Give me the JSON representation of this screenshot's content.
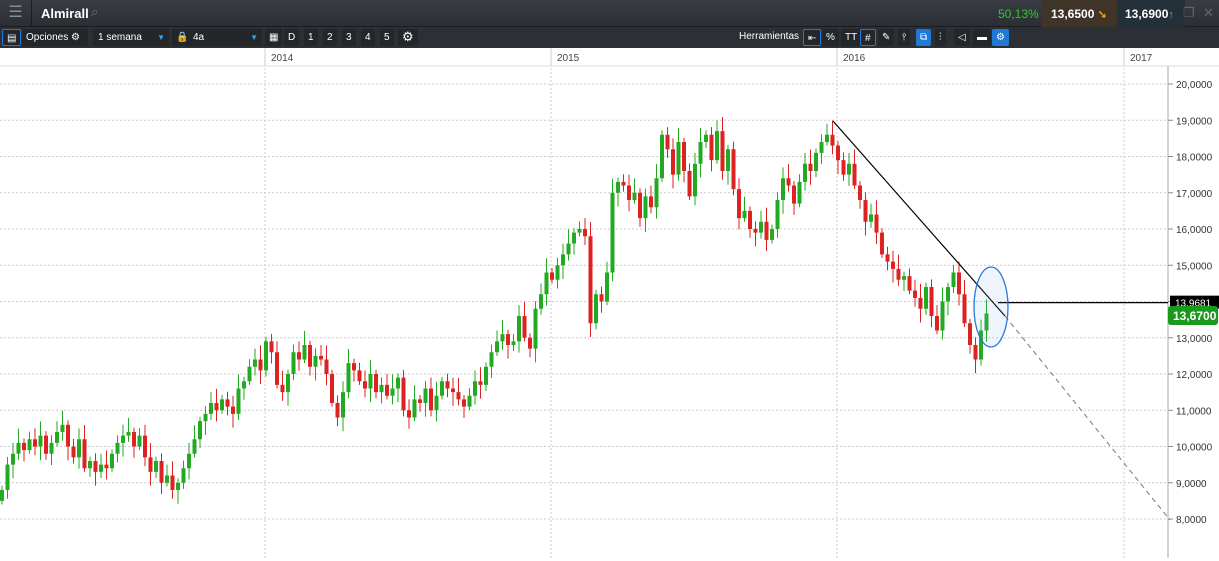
{
  "header": {
    "menu_icon": "hamburger-icon",
    "title": "Almirall",
    "search_icon": "search-icon",
    "change_pct": "50,13%",
    "bid": "13,6500",
    "ask": "13,6900"
  },
  "toolbar": {
    "options_label": "Opciones",
    "period": "1 semana",
    "range": "4a",
    "day_label": "D",
    "range_buttons": [
      "1",
      "2",
      "3",
      "4",
      "5"
    ],
    "tools_label": "Herramientas",
    "percent": "%",
    "text_tool": "TT"
  },
  "colors": {
    "up": "#22aa22",
    "down": "#dd2222",
    "price_badge": "#1a9a1a"
  },
  "chart_data": {
    "type": "candlestick",
    "title": "Almirall",
    "interval": "weekly",
    "years": [
      "2014",
      "2015",
      "2016",
      "2017"
    ],
    "y_ticks": [
      "20,0000",
      "19,0000",
      "18,0000",
      "17,0000",
      "16,0000",
      "15,0000",
      "14,0000",
      "13,0000",
      "12,0000",
      "11,0000",
      "10,0000",
      "9,0000",
      "8,0000"
    ],
    "ylim": [
      8,
      20
    ],
    "closes": [
      8.8,
      9.5,
      9.8,
      10.1,
      9.9,
      10.2,
      10.0,
      10.3,
      9.8,
      10.1,
      10.4,
      10.6,
      10.0,
      9.7,
      10.2,
      9.4,
      9.6,
      9.3,
      9.5,
      9.4,
      9.8,
      10.1,
      10.3,
      10.4,
      10.0,
      10.3,
      9.7,
      9.3,
      9.6,
      9.0,
      9.2,
      8.8,
      9.0,
      9.4,
      9.8,
      10.2,
      10.7,
      10.9,
      11.2,
      11.0,
      11.3,
      11.1,
      10.9,
      11.6,
      11.8,
      12.2,
      12.4,
      12.1,
      12.9,
      12.6,
      11.7,
      11.5,
      12.0,
      12.6,
      12.4,
      12.8,
      12.2,
      12.5,
      12.4,
      12.0,
      11.2,
      10.8,
      11.5,
      12.3,
      12.1,
      11.8,
      11.6,
      12.0,
      11.5,
      11.7,
      11.4,
      11.6,
      11.9,
      11.0,
      10.8,
      11.3,
      11.2,
      11.6,
      11.0,
      11.4,
      11.8,
      11.6,
      11.5,
      11.3,
      11.1,
      11.4,
      11.8,
      11.7,
      12.2,
      12.6,
      12.9,
      13.1,
      12.8,
      12.9,
      13.6,
      13.0,
      12.7,
      13.8,
      14.2,
      14.8,
      14.6,
      15.0,
      15.3,
      15.6,
      15.9,
      16.0,
      15.8,
      13.4,
      14.2,
      14.0,
      14.8,
      17.0,
      17.3,
      17.2,
      16.8,
      17.0,
      16.3,
      16.9,
      16.6,
      17.4,
      18.6,
      18.2,
      17.5,
      18.4,
      17.6,
      16.9,
      17.8,
      18.4,
      18.6,
      17.9,
      18.7,
      17.6,
      18.2,
      17.1,
      16.3,
      16.5,
      16.0,
      15.9,
      16.2,
      15.7,
      16.0,
      16.8,
      17.4,
      17.2,
      16.7,
      17.3,
      17.8,
      17.6,
      18.1,
      18.4,
      18.6,
      18.3,
      17.9,
      17.5,
      17.8,
      17.2,
      16.8,
      16.2,
      16.4,
      15.9,
      15.3,
      15.1,
      14.9,
      14.6,
      14.7,
      14.3,
      14.1,
      13.8,
      14.4,
      13.6,
      13.2,
      14.0,
      14.4,
      14.8,
      14.2,
      13.4,
      12.8,
      12.4,
      13.2,
      13.67
    ],
    "trendline_label": "13,9681",
    "last_price": "13,6700"
  }
}
